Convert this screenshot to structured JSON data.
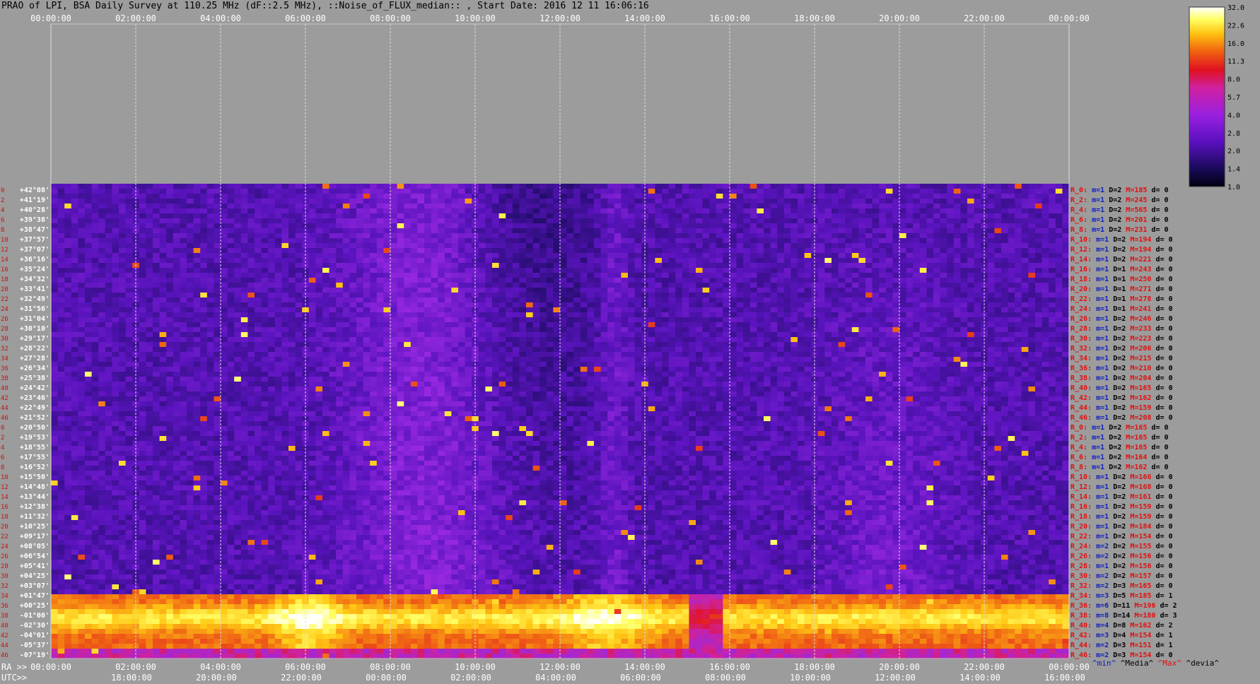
{
  "title": "PRAO of LPI, BSA Daily Survey at 110.25 MHz (dF::2.5 MHz), ::Noise_of_FLUX_median:: , Start Date: 2016 12 11 16:06:16",
  "chart_data": {
    "type": "heatmap",
    "title": "PRAO of LPI, BSA Daily Survey at 110.25 MHz (dF::2.5 MHz), ::Noise_of_FLUX_median:: , Start Date: 2016 12 11 16:06:16",
    "x_top_ticks": [
      "00:00:00",
      "02:00:00",
      "04:00:00",
      "06:00:00",
      "08:00:00",
      "10:00:00",
      "12:00:00",
      "14:00:00",
      "16:00:00",
      "18:00:00",
      "20:00:00",
      "22:00:00",
      "00:00:00"
    ],
    "ra_ticks": [
      "00:00:00",
      "02:00:00",
      "04:00:00",
      "06:00:00",
      "08:00:00",
      "10:00:00",
      "12:00:00",
      "14:00:00",
      "16:00:00",
      "18:00:00",
      "20:00:00",
      "22:00:00",
      "00:00:00"
    ],
    "utc_ticks": [
      "18:00:00",
      "20:00:00",
      "22:00:00",
      "00:00:00",
      "02:00:00",
      "04:00:00",
      "06:00:00",
      "08:00:00",
      "10:00:00",
      "12:00:00",
      "14:00:00",
      "16:00:00"
    ],
    "ra_prefix": "RA >>",
    "utc_prefix": "UTC>>",
    "dec_labels": [
      "+42°08'",
      "+41°19'",
      "+40°28'",
      "+39°38'",
      "+38°47'",
      "+37°57'",
      "+37°07'",
      "+36°16'",
      "+35°24'",
      "+34°32'",
      "+33°41'",
      "+32°49'",
      "+31°56'",
      "+31°04'",
      "+30°10'",
      "+29°17'",
      "+28°22'",
      "+27°28'",
      "+26°34'",
      "+25°38'",
      "+24°42'",
      "+23°46'",
      "+22°49'",
      "+21°52'",
      "+20°50'",
      "+19°53'",
      "+18°55'",
      "+17°55'",
      "+16°52'",
      "+15°50'",
      "+14°48'",
      "+13°44'",
      "+12°38'",
      "+11°32'",
      "+10°25'",
      "+09°17'",
      "+08°05'",
      "+06°54'",
      "+05°41'",
      "+04°25'",
      "+03°07'",
      "+01°47'",
      "+00°25'",
      "-01°00'",
      "-02°30'",
      "-04°01'",
      "-05°37'",
      "-07°19'"
    ],
    "row_numbers": [
      "0",
      "2",
      "4",
      "6",
      "8",
      "10",
      "12",
      "14",
      "16",
      "18",
      "20",
      "22",
      "24",
      "26",
      "28",
      "30",
      "32",
      "34",
      "36",
      "38",
      "40",
      "42",
      "44",
      "46",
      "0",
      "2",
      "4",
      "6",
      "8",
      "10",
      "12",
      "14",
      "16",
      "18",
      "20",
      "22",
      "24",
      "26",
      "28",
      "30",
      "32",
      "34",
      "36",
      "38",
      "40",
      "42",
      "44",
      "46"
    ],
    "row_stats": [
      {
        "r": "R_0:",
        "m": "m=1",
        "d": "D=2",
        "M": "M=185",
        "dv": "d= 0"
      },
      {
        "r": "R_2:",
        "m": "m=1",
        "d": "D=2",
        "M": "M=245",
        "dv": "d= 0"
      },
      {
        "r": "R_4:",
        "m": "m=1",
        "d": "D=2",
        "M": "M=565",
        "dv": "d= 0"
      },
      {
        "r": "R_6:",
        "m": "m=1",
        "d": "D=2",
        "M": "M=201",
        "dv": "d= 0"
      },
      {
        "r": "R_8:",
        "m": "m=1",
        "d": "D=2",
        "M": "M=231",
        "dv": "d= 0"
      },
      {
        "r": "R_10:",
        "m": "m=1",
        "d": "D=2",
        "M": "M=194",
        "dv": "d= 0"
      },
      {
        "r": "R_12:",
        "m": "m=1",
        "d": "D=2",
        "M": "M=194",
        "dv": "d= 0"
      },
      {
        "r": "R_14:",
        "m": "m=1",
        "d": "D=2",
        "M": "M=221",
        "dv": "d= 0"
      },
      {
        "r": "R_16:",
        "m": "m=1",
        "d": "D=1",
        "M": "M=243",
        "dv": "d= 0"
      },
      {
        "r": "R_18:",
        "m": "m=1",
        "d": "D=1",
        "M": "M=250",
        "dv": "d= 0"
      },
      {
        "r": "R_20:",
        "m": "m=1",
        "d": "D=1",
        "M": "M=271",
        "dv": "d= 0"
      },
      {
        "r": "R_22:",
        "m": "m=1",
        "d": "D=1",
        "M": "M=278",
        "dv": "d= 0"
      },
      {
        "r": "R_24:",
        "m": "m=1",
        "d": "D=1",
        "M": "M=241",
        "dv": "d= 0"
      },
      {
        "r": "R_26:",
        "m": "m=1",
        "d": "D=2",
        "M": "M=246",
        "dv": "d= 0"
      },
      {
        "r": "R_28:",
        "m": "m=1",
        "d": "D=2",
        "M": "M=233",
        "dv": "d= 0"
      },
      {
        "r": "R_30:",
        "m": "m=1",
        "d": "D=2",
        "M": "M=223",
        "dv": "d= 0"
      },
      {
        "r": "R_32:",
        "m": "m=1",
        "d": "D=2",
        "M": "M=206",
        "dv": "d= 0"
      },
      {
        "r": "R_34:",
        "m": "m=1",
        "d": "D=2",
        "M": "M=215",
        "dv": "d= 0"
      },
      {
        "r": "R_36:",
        "m": "m=1",
        "d": "D=2",
        "M": "M=210",
        "dv": "d= 0"
      },
      {
        "r": "R_38:",
        "m": "m=1",
        "d": "D=2",
        "M": "M=204",
        "dv": "d= 0"
      },
      {
        "r": "R_40:",
        "m": "m=1",
        "d": "D=2",
        "M": "M=165",
        "dv": "d= 0"
      },
      {
        "r": "R_42:",
        "m": "m=1",
        "d": "D=2",
        "M": "M=162",
        "dv": "d= 0"
      },
      {
        "r": "R_44:",
        "m": "m=1",
        "d": "D=2",
        "M": "M=159",
        "dv": "d= 0"
      },
      {
        "r": "R_46:",
        "m": "m=1",
        "d": "D=2",
        "M": "M=208",
        "dv": "d= 0"
      },
      {
        "r": "R_0:",
        "m": "m=1",
        "d": "D=2",
        "M": "M=165",
        "dv": "d= 0"
      },
      {
        "r": "R_2:",
        "m": "m=1",
        "d": "D=2",
        "M": "M=165",
        "dv": "d= 0"
      },
      {
        "r": "R_4:",
        "m": "m=1",
        "d": "D=2",
        "M": "M=165",
        "dv": "d= 0"
      },
      {
        "r": "R_6:",
        "m": "m=1",
        "d": "D=2",
        "M": "M=164",
        "dv": "d= 0"
      },
      {
        "r": "R_8:",
        "m": "m=1",
        "d": "D=2",
        "M": "M=162",
        "dv": "d= 0"
      },
      {
        "r": "R_10:",
        "m": "m=1",
        "d": "D=2",
        "M": "M=166",
        "dv": "d= 0"
      },
      {
        "r": "R_12:",
        "m": "m=1",
        "d": "D=2",
        "M": "M=168",
        "dv": "d= 0"
      },
      {
        "r": "R_14:",
        "m": "m=1",
        "d": "D=2",
        "M": "M=161",
        "dv": "d= 0"
      },
      {
        "r": "R_16:",
        "m": "m=1",
        "d": "D=2",
        "M": "M=159",
        "dv": "d= 0"
      },
      {
        "r": "R_18:",
        "m": "m=1",
        "d": "D=2",
        "M": "M=159",
        "dv": "d= 0"
      },
      {
        "r": "R_20:",
        "m": "m=1",
        "d": "D=2",
        "M": "M=184",
        "dv": "d= 0"
      },
      {
        "r": "R_22:",
        "m": "m=1",
        "d": "D=2",
        "M": "M=154",
        "dv": "d= 0"
      },
      {
        "r": "R_24:",
        "m": "m=2",
        "d": "D=2",
        "M": "M=155",
        "dv": "d= 0"
      },
      {
        "r": "R_26:",
        "m": "m=2",
        "d": "D=2",
        "M": "M=156",
        "dv": "d= 0"
      },
      {
        "r": "R_28:",
        "m": "m=1",
        "d": "D=2",
        "M": "M=156",
        "dv": "d= 0"
      },
      {
        "r": "R_30:",
        "m": "m=2",
        "d": "D=2",
        "M": "M=157",
        "dv": "d= 0"
      },
      {
        "r": "R_32:",
        "m": "m=2",
        "d": "D=3",
        "M": "M=165",
        "dv": "d= 0"
      },
      {
        "r": "R_34:",
        "m": "m=3",
        "d": "D=5",
        "M": "M=185",
        "dv": "d= 1"
      },
      {
        "r": "R_36:",
        "m": "m=6",
        "d": "D=11",
        "M": "M=196",
        "dv": "d= 2"
      },
      {
        "r": "R_38:",
        "m": "m=8",
        "d": "D=14",
        "M": "M=180",
        "dv": "d= 3"
      },
      {
        "r": "R_40:",
        "m": "m=4",
        "d": "D=8",
        "M": "M=162",
        "dv": "d= 2"
      },
      {
        "r": "R_42:",
        "m": "m=3",
        "d": "D=4",
        "M": "M=154",
        "dv": "d= 1"
      },
      {
        "r": "R_44:",
        "m": "m=2",
        "d": "D=3",
        "M": "M=151",
        "dv": "d= 1"
      },
      {
        "r": "R_46:",
        "m": "m=2",
        "d": "D=3",
        "M": "M=154",
        "dv": "d= 0"
      }
    ],
    "stat_footer": {
      "min": "^min^",
      "median": "^Media^",
      "max": "^Max^",
      "devia": "^devia^"
    },
    "colorbar": {
      "ticks": [
        "32.0",
        "22.6",
        "16.0",
        "11.3",
        "8.0",
        "5.7",
        "4.0",
        "2.8",
        "2.0",
        "1.4",
        "1.0"
      ],
      "range": [
        1.0,
        32.0
      ],
      "scale": "log"
    }
  },
  "colors": {
    "background": "#9c9c9c",
    "stat_blue": "#1020c0",
    "stat_red": "#e01010",
    "stat_dark": "#000000"
  }
}
